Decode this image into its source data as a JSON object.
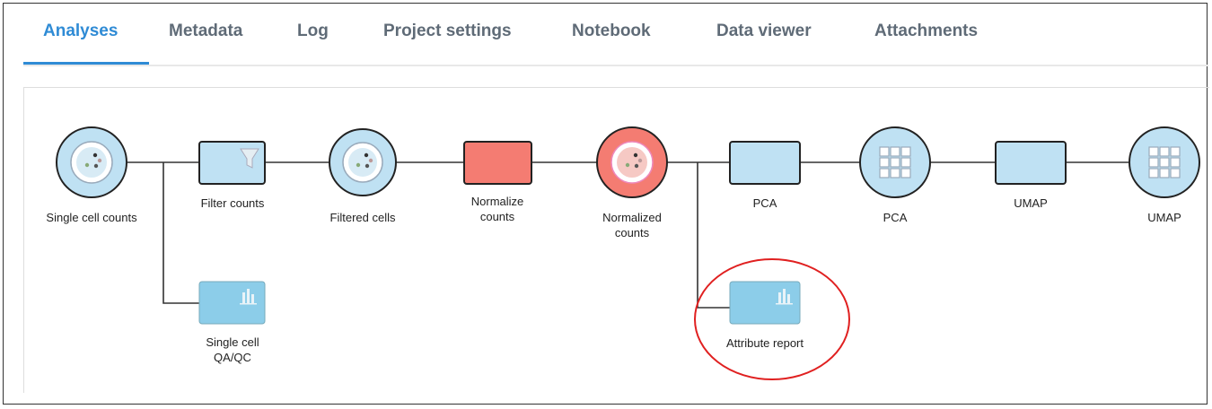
{
  "tabs": [
    {
      "label": "Analyses",
      "active": true
    },
    {
      "label": "Metadata",
      "active": false
    },
    {
      "label": "Log",
      "active": false
    },
    {
      "label": "Project settings",
      "active": false
    },
    {
      "label": "Notebook",
      "active": false
    },
    {
      "label": "Data viewer",
      "active": false
    },
    {
      "label": "Attachments",
      "active": false
    }
  ],
  "nodes": {
    "single_cell_counts": {
      "label": "Single cell counts",
      "kind": "data-node",
      "icon": "single-cell-icon"
    },
    "filter_counts": {
      "label": "Filter counts",
      "kind": "task-node",
      "icon": "filter-icon"
    },
    "filtered_cells": {
      "label": "Filtered cells",
      "kind": "data-node",
      "icon": "single-cell-icon"
    },
    "normalize_counts": {
      "label_line1": "Normalize",
      "label_line2": "counts",
      "kind": "task-node"
    },
    "normalized_counts": {
      "label_line1": "Normalized",
      "label_line2": "counts",
      "kind": "data-node",
      "icon": "single-cell-icon"
    },
    "pca_task": {
      "label": "PCA",
      "kind": "task-node"
    },
    "pca_data": {
      "label": "PCA",
      "kind": "data-node",
      "icon": "grid-icon"
    },
    "umap_task": {
      "label": "UMAP",
      "kind": "task-node"
    },
    "umap_data": {
      "label": "UMAP",
      "kind": "data-node",
      "icon": "grid-icon"
    },
    "single_cell_qaqc": {
      "label_line1": "Single cell",
      "label_line2": "QA/QC",
      "kind": "report-node",
      "icon": "bar-chart-icon"
    },
    "attribute_report": {
      "label": "Attribute report",
      "kind": "report-node",
      "icon": "bar-chart-icon"
    }
  },
  "colors": {
    "accent": "#2f8bd5",
    "node_fill": "#bfe1f3",
    "report_fill": "#8ccde9",
    "selected_fill": "#f47c72",
    "highlight_circle": "#e02020"
  }
}
